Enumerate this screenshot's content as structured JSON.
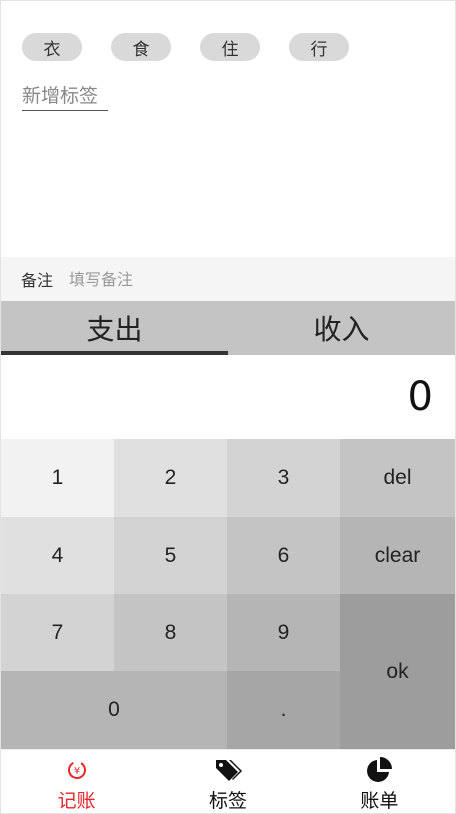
{
  "tags": [
    "衣",
    "食",
    "住",
    "行"
  ],
  "new_tag_label": "新增标签",
  "notes": {
    "label": "备注",
    "placeholder": "填写备注"
  },
  "type_tabs": [
    {
      "label": "支出",
      "active": true
    },
    {
      "label": "收入",
      "active": false
    }
  ],
  "amount": "0",
  "keypad": {
    "k1": "1",
    "k2": "2",
    "k3": "3",
    "del": "del",
    "k4": "4",
    "k5": "5",
    "k6": "6",
    "clear": "clear",
    "k7": "7",
    "k8": "8",
    "k9": "9",
    "ok": "ok",
    "k0": "0",
    "dot": "."
  },
  "nav": [
    {
      "label": "记账",
      "icon": "money-circle-icon",
      "active": true
    },
    {
      "label": "标签",
      "icon": "tags-icon",
      "active": false
    },
    {
      "label": "账单",
      "icon": "pie-chart-icon",
      "active": false
    }
  ],
  "colors": {
    "active": "#e8262b"
  }
}
